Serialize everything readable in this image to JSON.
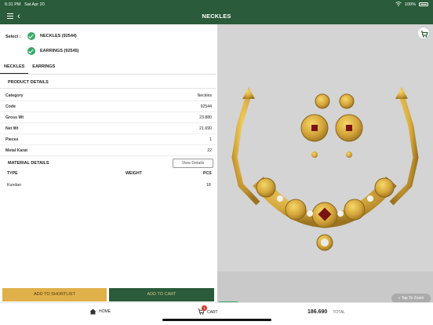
{
  "status": {
    "time": "6:31 PM",
    "date": "Sat Apr 20",
    "battery": "100%"
  },
  "nav": {
    "title": "NECKLES"
  },
  "select": {
    "label": "Select :",
    "items": [
      {
        "label": "NECKLES (92544)",
        "checked": true
      },
      {
        "label": "EARRINGS (92545)",
        "checked": true
      }
    ]
  },
  "tabs": [
    "NECKLES",
    "EARRINGS"
  ],
  "product": {
    "heading": "PRODUCT DETAILS",
    "rows": [
      {
        "key": "Category",
        "value": "Neckles"
      },
      {
        "key": "Code",
        "value": "92544"
      },
      {
        "key": "Gross Wt",
        "value": "23.880"
      },
      {
        "key": "Net Wt",
        "value": "21.690"
      },
      {
        "key": "Pieces",
        "value": "1"
      },
      {
        "key": "Metal Karat",
        "value": "22"
      }
    ]
  },
  "material": {
    "heading": "MATERIAL DETAILS",
    "view_label": "View Details",
    "columns": [
      "TYPE",
      "WEIGHT",
      "PCS"
    ],
    "rows": [
      {
        "type": "Kundan",
        "weight": "",
        "pcs": "18"
      }
    ]
  },
  "actions": {
    "shortlist": "ADD TO SHORTLIST",
    "cart": "ADD TO CART"
  },
  "image": {
    "zoom_hint": "Tap To Zoom"
  },
  "bottom": {
    "home": "HOME",
    "cart": "CART",
    "cart_count": "1",
    "total_value": "186.690",
    "total_label": "TOTAL"
  },
  "colors": {
    "brand": "#2a5b3a",
    "accent": "#e0b04a",
    "check": "#3aa86b"
  }
}
